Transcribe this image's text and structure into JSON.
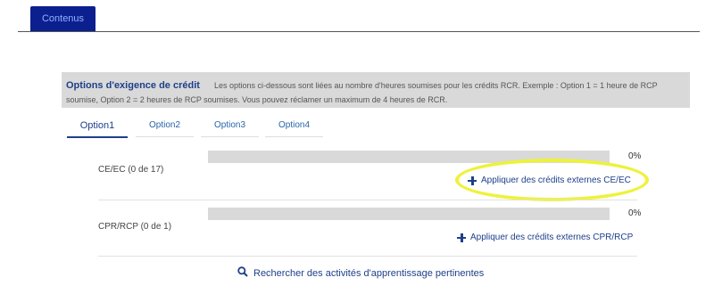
{
  "top_tab": {
    "label": "Contenus"
  },
  "header": {
    "title": "Options d'exigence de crédit",
    "description": "Les options ci-dessous sont liées au nombre d'heures soumises pour les crédits RCR. Exemple : Option 1 = 1 heure de RCP soumise, Option 2 = 2 heures de RCP soumises. Vous pouvez réclamer un maximum de 4 heures de RCR."
  },
  "option_tabs": [
    {
      "label": "Option1",
      "active": true
    },
    {
      "label": "Option2",
      "active": false
    },
    {
      "label": "Option3",
      "active": false
    },
    {
      "label": "Option4",
      "active": false
    }
  ],
  "rows": [
    {
      "label": "CE/EC (0 de 17)",
      "progress": 0,
      "percent_text": "0%",
      "link_label": "Appliquer des crédits externes CE/EC",
      "link_icon": "plus-icon"
    },
    {
      "label": "CPR/RCP (0 de 1)",
      "progress": 0,
      "percent_text": "0%",
      "link_label": "Appliquer des crédits externes CPR/RCP",
      "link_icon": "plus-icon"
    }
  ],
  "search": {
    "label": "Rechercher des activités d'apprentissage pertinentes",
    "icon": "search-icon"
  },
  "colors": {
    "accent": "#1d3f8a",
    "tab_bg": "#0b1f8f",
    "highlight": "#eef23a",
    "bar_track": "#d9d9d9"
  }
}
